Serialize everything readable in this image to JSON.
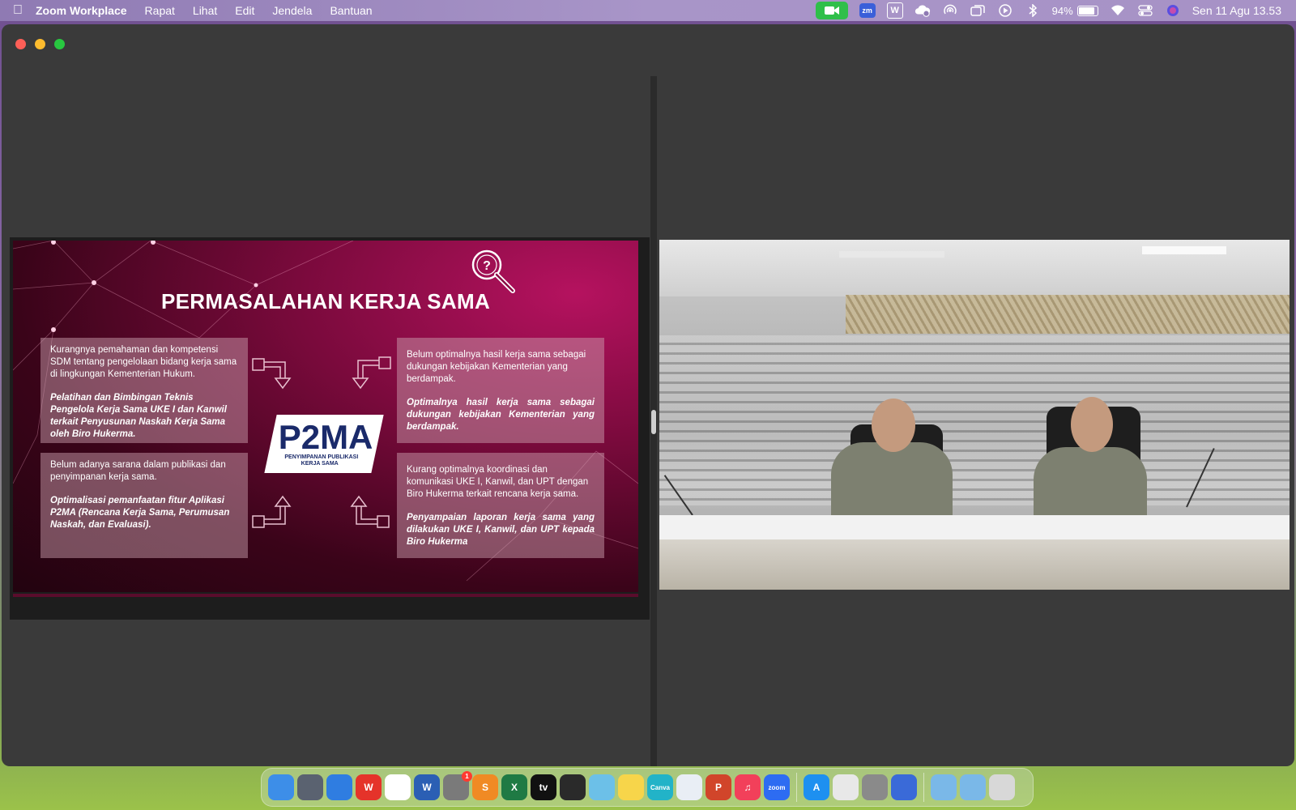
{
  "menubar": {
    "app_name": "Zoom Workplace",
    "menus": [
      "Rapat",
      "Lihat",
      "Edit",
      "Jendela",
      "Bantuan"
    ],
    "battery_percent": "94%",
    "battery_level": 0.94,
    "clock": "Sen 11 Agu  13.53",
    "status_icons": [
      "zoom-video-icon",
      "zoom-icon",
      "wps-icon",
      "cloud-icon",
      "airdrop-icon",
      "screen-mirror-icon",
      "play-icon",
      "bluetooth-icon",
      "battery-icon",
      "wifi-icon",
      "control-center-icon",
      "siri-icon"
    ]
  },
  "slide": {
    "title": "PERMASALAHAN KERJA SAMA",
    "logo_main": "P2MA",
    "logo_sub_1": "PENYIMPANAN PUBLIKASI",
    "logo_sub_2": "KERJA SAMA",
    "boxes": [
      {
        "plain": "Kurangnya pemahaman dan kompetensi SDM tentang pengelolaan bidang kerja sama di lingkungan Kementerian Hukum.",
        "bold": "Pelatihan dan Bimbingan Teknis Pengelola Kerja Sama UKE I dan Kanwil terkait Penyusunan Naskah Kerja Sama oleh Biro Hukerma."
      },
      {
        "plain": "Belum optimalnya hasil kerja sama sebagai dukungan kebijakan Kementerian yang berdampak.",
        "bold": "Optimalnya hasil kerja sama sebagai dukungan kebijakan Kementerian yang berdampak."
      },
      {
        "plain": "Belum adanya sarana dalam publikasi dan penyimpanan kerja sama.",
        "bold": "Optimalisasi pemanfaatan fitur Aplikasi P2MA (Rencana Kerja Sama, Perumusan Naskah, dan Evaluasi)."
      },
      {
        "plain": "Kurang optimalnya koordinasi dan komunikasi UKE I, Kanwil, dan UPT dengan Biro Hukerma terkait rencana kerja sama.",
        "bold": "Penyampaian laporan kerja sama yang dilakukan UKE I, Kanwil, dan UPT kepada Biro Hukerma"
      }
    ]
  },
  "dock": {
    "items": [
      {
        "name": "finder-icon",
        "label": "",
        "color": "#3d8ee8"
      },
      {
        "name": "screenshot-icon",
        "label": "",
        "color": "#5a6270"
      },
      {
        "name": "safari-icon",
        "label": "",
        "color": "#2f7de1"
      },
      {
        "name": "wps-icon",
        "label": "W",
        "color": "#e5332a"
      },
      {
        "name": "chrome-icon",
        "label": "",
        "color": "#ffffff"
      },
      {
        "name": "word-icon",
        "label": "W",
        "color": "#2b5fb4"
      },
      {
        "name": "system-settings-icon",
        "label": "",
        "color": "#7a7a7a",
        "badge": "1"
      },
      {
        "name": "sublime-icon",
        "label": "S",
        "color": "#f08a24"
      },
      {
        "name": "excel-icon",
        "label": "X",
        "color": "#1f7a44"
      },
      {
        "name": "apple-tv-icon",
        "label": "tv",
        "color": "#111111"
      },
      {
        "name": "mission-control-icon",
        "label": "",
        "color": "#2a2a2a"
      },
      {
        "name": "maps-icon",
        "label": "",
        "color": "#6cc0e8"
      },
      {
        "name": "notes-icon",
        "label": "",
        "color": "#f7d54a"
      },
      {
        "name": "canva-icon",
        "label": "Canva",
        "color": "#22b3c8"
      },
      {
        "name": "freeform-icon",
        "label": "",
        "color": "#e9eef5"
      },
      {
        "name": "powerpoint-icon",
        "label": "P",
        "color": "#d1452a"
      },
      {
        "name": "music-icon",
        "label": "♫",
        "color": "#f2405a"
      },
      {
        "name": "zoom-icon",
        "label": "zoom",
        "color": "#2d6cf2"
      },
      {
        "name": "app-store-icon",
        "label": "A",
        "color": "#1e90f0"
      },
      {
        "name": "launchpad-icon",
        "label": "",
        "color": "#e8e8e8"
      },
      {
        "name": "printer-icon",
        "label": "",
        "color": "#8a8a8a"
      },
      {
        "name": "rostrum-icon",
        "label": "",
        "color": "#3a6ad8"
      },
      {
        "name": "applications-folder-icon",
        "label": "",
        "color": "#7ab8e8"
      },
      {
        "name": "downloads-folder-icon",
        "label": "",
        "color": "#7ab8e8"
      },
      {
        "name": "trash-icon",
        "label": "",
        "color": "#d8d8d8"
      }
    ]
  }
}
